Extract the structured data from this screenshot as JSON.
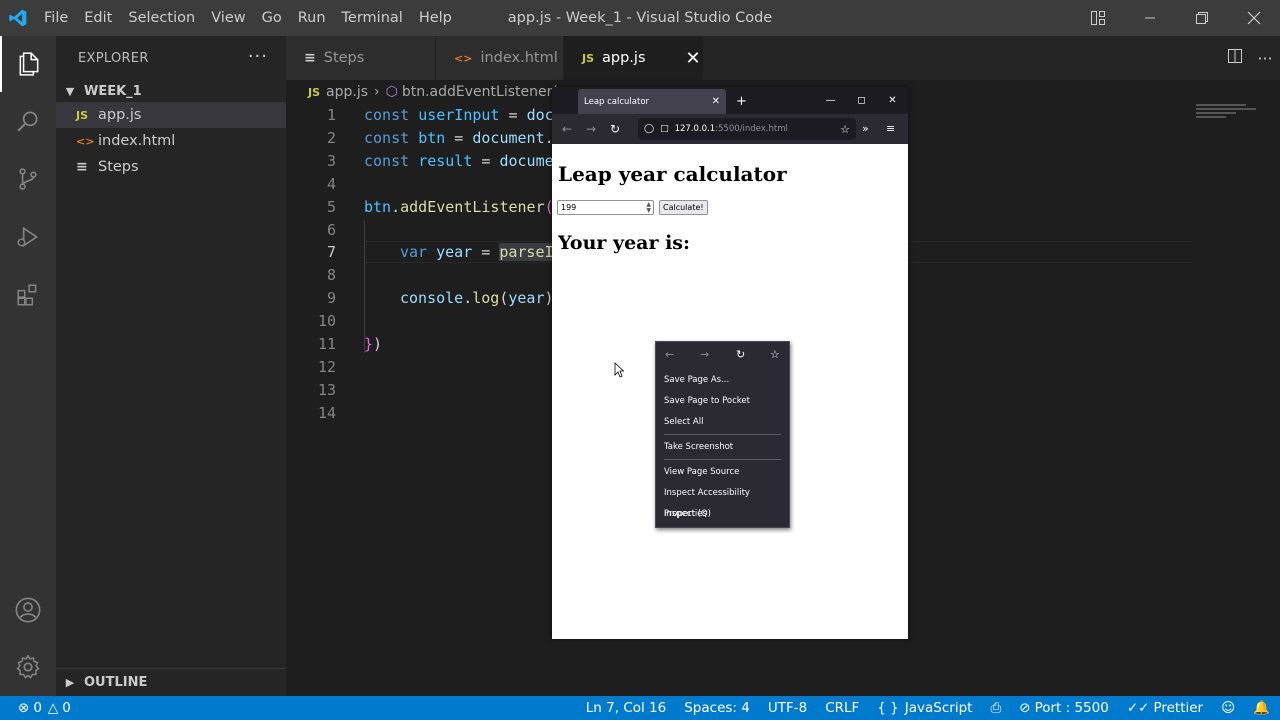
{
  "window": {
    "title": "app.js - Week_1 - Visual Studio Code",
    "menu": [
      "File",
      "Edit",
      "Selection",
      "View",
      "Go",
      "Run",
      "Terminal",
      "Help"
    ]
  },
  "colors": {
    "accent": "#007acc",
    "js_icon": "#cbcb41",
    "html_icon": "#e37933"
  },
  "sidebar": {
    "header": "EXPLORER",
    "folder": "WEEK_1",
    "files": [
      {
        "name": "app.js",
        "icon": "JS"
      },
      {
        "name": "index.html",
        "icon": "<>"
      },
      {
        "name": "Steps",
        "icon": "≡"
      }
    ],
    "outline": "OUTLINE"
  },
  "tabs": [
    {
      "label": "Steps",
      "icon": "≡"
    },
    {
      "label": "index.html",
      "icon": "<>"
    },
    {
      "label": "app.js",
      "icon": "JS"
    }
  ],
  "breadcrumb": {
    "file": "app.js",
    "symbol": "btn.addEventListener("
  },
  "editor": {
    "line_numbers": [
      "1",
      "2",
      "3",
      "4",
      "5",
      "6",
      "7",
      "8",
      "9",
      "10",
      "11",
      "12",
      "13",
      "14"
    ],
    "current_line": "7"
  },
  "browser": {
    "tab_title": "Leap calculator",
    "url_host": "127.0.0.1",
    "url_path": ":5500/index.html",
    "heading": "Leap year calculator",
    "input_value": "199",
    "button_label": "Calculate!",
    "result_heading": "Your year is:"
  },
  "context_menu": {
    "items": [
      "Save Page As...",
      "Save Page to Pocket",
      "Select All",
      "Take Screenshot",
      "View Page Source",
      "Inspect Accessibility Properties",
      "Inspect (Q)"
    ]
  },
  "statusbar": {
    "errors": "0",
    "warnings": "0",
    "position": "Ln 7, Col 16",
    "spaces": "Spaces: 4",
    "encoding": "UTF-8",
    "eol": "CRLF",
    "language": "JavaScript",
    "port": "Port : 5500",
    "formatter": "Prettier"
  }
}
